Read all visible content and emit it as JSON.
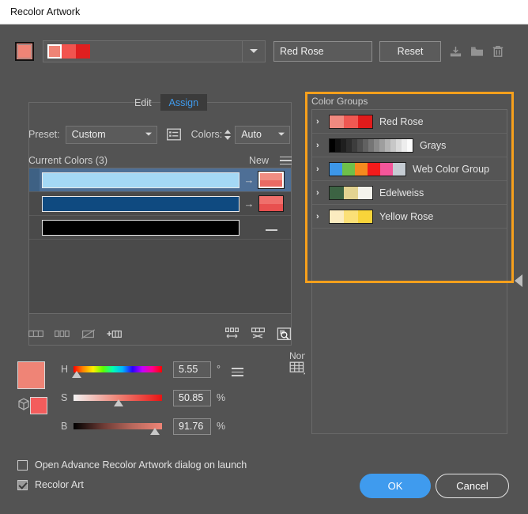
{
  "window": {
    "title": "Recolor Artwork"
  },
  "top": {
    "art_swatch_color": "#ef8476",
    "group_strip": [
      "#ef8476",
      "#f2544f",
      "#e01f1f"
    ],
    "name_value": "Red Rose",
    "reset_label": "Reset",
    "icons": [
      {
        "name": "save-to-swatches-icon",
        "glyph": "download"
      },
      {
        "name": "new-color-group-folder-icon",
        "glyph": "folder"
      },
      {
        "name": "delete-color-group-icon",
        "glyph": "trash"
      }
    ]
  },
  "tabs": [
    {
      "label": "Edit",
      "active": false
    },
    {
      "label": "Assign",
      "active": true
    }
  ],
  "assign": {
    "preset_label": "Preset:",
    "preset_value": "Custom",
    "preset_options": [
      "Custom"
    ],
    "colors_label": "Colors:",
    "colors_value": "Auto",
    "colors_options": [
      "Auto"
    ],
    "current_colors_label": "Current Colors (3)",
    "new_label": "New",
    "rows": [
      {
        "current": "#a4d8f5",
        "arrow": "→",
        "new_top": "#f08d82",
        "new_bottom": "#ea6a63",
        "selected": true,
        "new_active": true,
        "has_new": true
      },
      {
        "current": "#0f4a80",
        "arrow": "→",
        "new_top": "#ef6f6b",
        "new_bottom": "#e8504f",
        "selected": false,
        "new_active": false,
        "has_new": true
      },
      {
        "current": "#000000",
        "arrow": "",
        "new_top": "",
        "new_bottom": "",
        "selected": false,
        "new_active": false,
        "has_new": false
      }
    ],
    "tools_left": [
      {
        "name": "merge-colors-icon"
      },
      {
        "name": "separate-colors-icon"
      },
      {
        "name": "exclude-colors-icon"
      },
      {
        "name": "add-color-row-icon"
      }
    ],
    "tools_right": [
      {
        "name": "randomly-change-color-order-icon"
      },
      {
        "name": "randomly-change-saturation-brightness-icon"
      },
      {
        "name": "color-preview-icon"
      }
    ]
  },
  "hsb": {
    "large_swatch": "#ef8476",
    "small_swatch": "#f35c5c",
    "cube_icon": "color-mode-cube-icon",
    "menu_icon": "slider-options-menu-icon",
    "none_label": "None",
    "none_icon": "none-color-grid-icon",
    "sliders": [
      {
        "channel": "H",
        "value": "5.55",
        "unit": "°",
        "position_pct": 4
      },
      {
        "channel": "S",
        "value": "50.85",
        "unit": "%",
        "position_pct": 51
      },
      {
        "channel": "B",
        "value": "91.76",
        "unit": "%",
        "position_pct": 92
      }
    ]
  },
  "color_groups": {
    "title": "Color Groups",
    "highlight_color": "#f7a01c",
    "items": [
      {
        "name": "Red Rose",
        "swatches": [
          "#f08a80",
          "#ef5852",
          "#e11b1b"
        ],
        "swatch_w": 18
      },
      {
        "name": "Grays",
        "swatches": [
          "#000000",
          "#121212",
          "#1f1f1f",
          "#2d2d2d",
          "#3d3d3d",
          "#4e4e4e",
          "#616161",
          "#757575",
          "#8a8a8a",
          "#9e9e9e",
          "#b3b3b3",
          "#c7c7c7",
          "#dadada",
          "#ededed",
          "#fbfbfb"
        ],
        "swatch_w": 7
      },
      {
        "name": "Web Color Group",
        "swatches": [
          "#3d97e8",
          "#6ec04a",
          "#f58a1f",
          "#f31b1b",
          "#f4569a",
          "#c5ccd3"
        ],
        "swatch_w": 16
      },
      {
        "name": "Edelweiss",
        "swatches": [
          "#3c6343",
          "#e3d391",
          "#f4f3ec"
        ],
        "swatch_w": 18
      },
      {
        "name": "Yellow Rose",
        "swatches": [
          "#fbecc0",
          "#fbe077",
          "#f8d43a"
        ],
        "swatch_w": 18
      }
    ],
    "collapse_icon": "collapse-panel-arrow-icon"
  },
  "footer": {
    "checkbox_advance": {
      "label": "Open Advance Recolor Artwork dialog on launch",
      "checked": false
    },
    "checkbox_recolor": {
      "label": "Recolor Art",
      "checked": true
    },
    "ok_label": "OK",
    "cancel_label": "Cancel"
  }
}
